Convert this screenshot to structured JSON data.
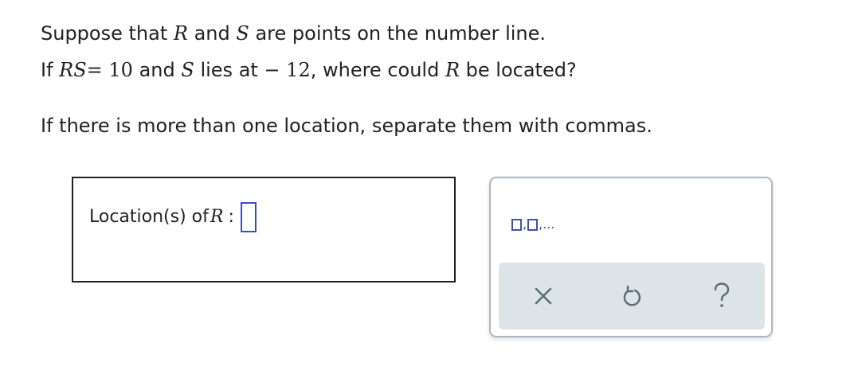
{
  "problem": {
    "line1": {
      "t1": "Suppose that ",
      "var_r": "R",
      "t2": " and ",
      "var_s": "S",
      "t3": " are points on the number line."
    },
    "line2": {
      "t1": "If ",
      "seg": "RS",
      "eq": "= 10",
      "t2": " and ",
      "var_s": "S",
      "t3": " lies at ",
      "value": "− 12",
      "t4": ", where could ",
      "var_r": "R",
      "t5": " be located?"
    },
    "instruction": "If there is more than one location, separate them with commas."
  },
  "answer": {
    "label": "Location(s) of ",
    "var": "R",
    "colon": " :",
    "value": ""
  },
  "toolbar": {
    "template_suffix": ",...",
    "template_sep": ",",
    "clear_icon": "close-icon",
    "undo_icon": "undo-icon",
    "help_icon": "help-icon",
    "icon_color": "#3b4fb8",
    "button_icon_color": "#5a6b78"
  }
}
